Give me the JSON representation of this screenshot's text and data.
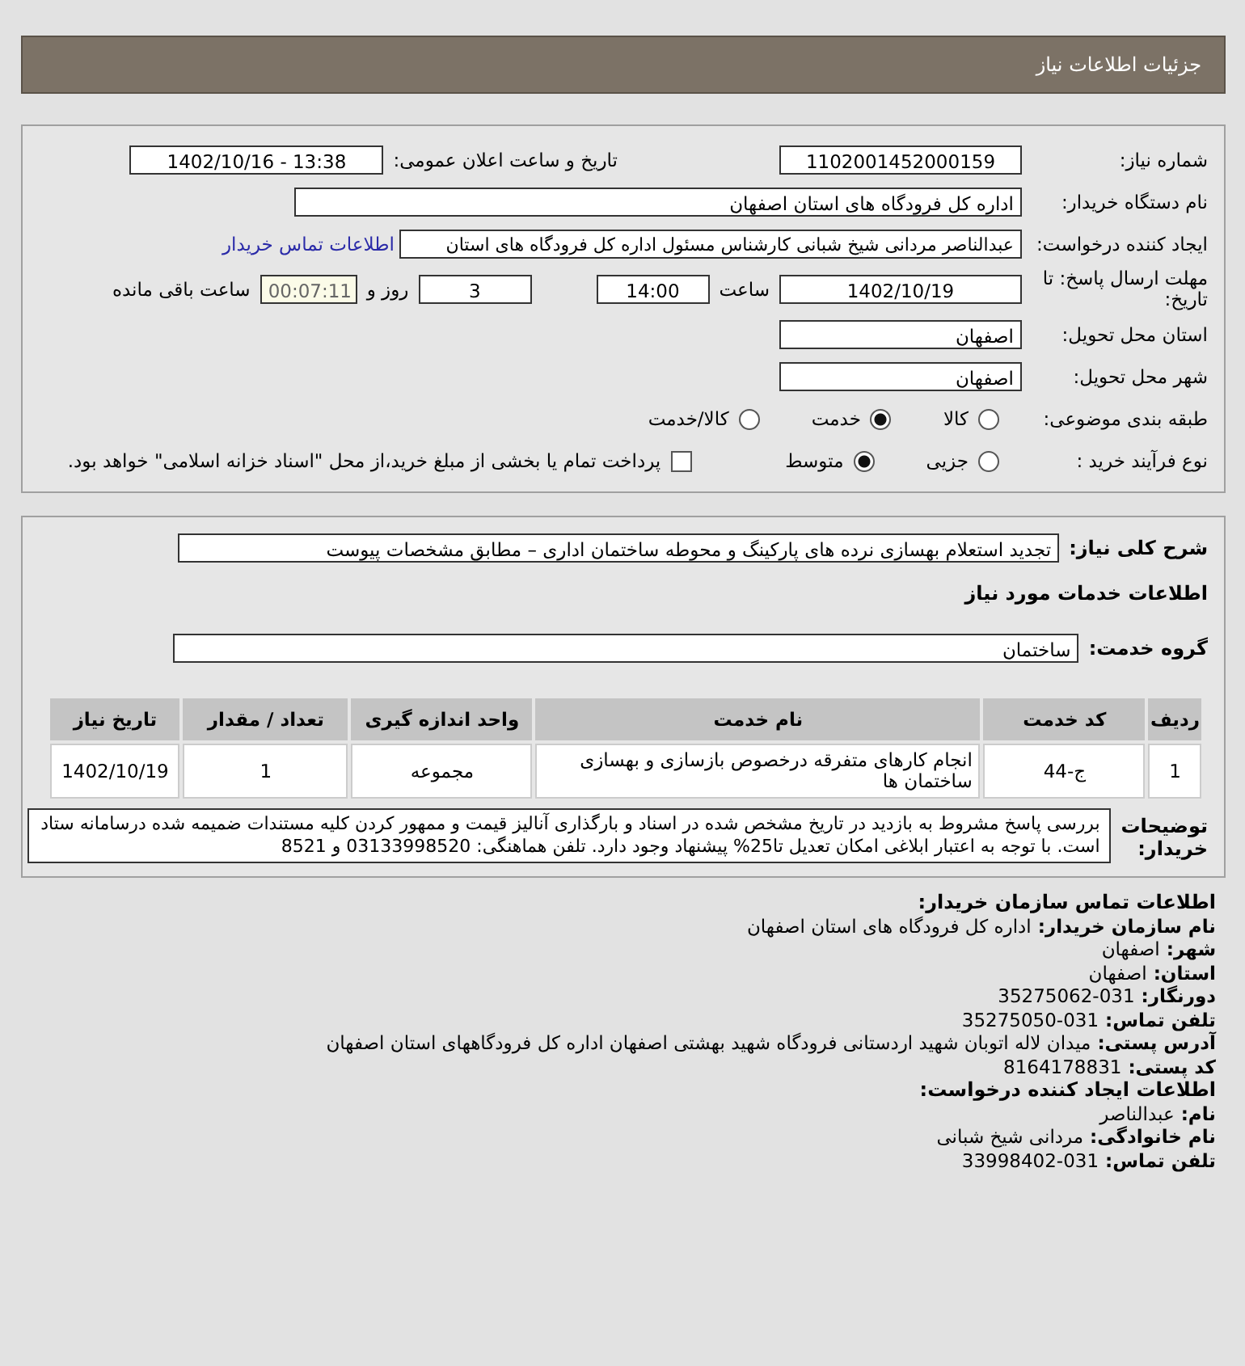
{
  "header": {
    "title": "جزئیات اطلاعات نیاز"
  },
  "details": {
    "need_number": {
      "label": "شماره نیاز:",
      "value": "1102001452000159"
    },
    "announce": {
      "label": "تاریخ و ساعت اعلان عمومی:",
      "value": "1402/10/16 - 13:38"
    },
    "buyer_org": {
      "label": "نام دستگاه خریدار:",
      "value": "اداره کل فرودگاه های استان اصفهان"
    },
    "creator": {
      "label": "ایجاد کننده درخواست:",
      "value": "عبدالناصر مردانی شیخ شبانی کارشناس مسئول  اداره کل فرودگاه های استان",
      "link": "اطلاعات تماس خریدار"
    },
    "deadline": {
      "label": "مهلت ارسال پاسخ: تا تاریخ:",
      "date": "1402/10/19",
      "time_label": "ساعت",
      "time": "14:00",
      "days": "3",
      "days_label": "روز و",
      "remaining": "00:07:11",
      "remaining_label": "ساعت باقی مانده"
    },
    "province": {
      "label": "استان محل تحویل:",
      "value": "اصفهان"
    },
    "city": {
      "label": "شهر محل تحویل:",
      "value": "اصفهان"
    },
    "category": {
      "label": "طبقه بندی موضوعی:",
      "options": [
        {
          "label": "کالا",
          "selected": false
        },
        {
          "label": "خدمت",
          "selected": true
        },
        {
          "label": "کالا/خدمت",
          "selected": false
        }
      ]
    },
    "process": {
      "label": "نوع فرآیند خرید :",
      "options": [
        {
          "label": "جزیی",
          "selected": false
        },
        {
          "label": "متوسط",
          "selected": true
        }
      ],
      "treasury": {
        "label": "پرداخت تمام یا بخشی از مبلغ خرید،از محل \"اسناد خزانه اسلامی\" خواهد بود.",
        "checked": false
      }
    }
  },
  "services": {
    "description": {
      "label": "شرح کلی نیاز:",
      "value": "تجدید استعلام بهسازی نرده های پارکینگ و محوطه ساختمان اداری – مطابق مشخصات پیوست"
    },
    "section_title": "اطلاعات خدمات مورد نیاز",
    "group": {
      "label": "گروه خدمت:",
      "value": "ساختمان"
    },
    "table": {
      "columns": [
        "ردیف",
        "کد خدمت",
        "نام خدمت",
        "واحد اندازه گیری",
        "تعداد / مقدار",
        "تاریخ نیاز"
      ],
      "rows": [
        [
          "1",
          "ج-44",
          "انجام کارهای متفرقه درخصوص بازسازی و بهسازی ساختمان ها",
          "مجموعه",
          "1",
          "1402/10/19"
        ]
      ]
    },
    "notes": {
      "label": "توضیحات خریدار:",
      "value": "بررسی پاسخ مشروط به بازدید در تاریخ مشخص شده در اسناد و بارگذاری آنالیز قیمت و ممهور کردن کلیه مستندات ضمیمه شده درسامانه ستاد است. با توجه به اعتبار ابلاغی امکان تعدیل تا25% پیشنهاد وجود دارد. تلفن هماهنگی: 03133998520 و 8521"
    }
  },
  "contact": {
    "title": "اطلاعات تماس سازمان خریدار:",
    "lines": [
      {
        "label": "نام سازمان خریدار:",
        "value": "اداره کل فرودگاه های استان اصفهان"
      },
      {
        "label": "شهر:",
        "value": "اصفهان"
      },
      {
        "label": "استان:",
        "value": "اصفهان"
      },
      {
        "label": "دورنگار:",
        "value": "35275062-031"
      },
      {
        "label": "تلفن تماس:",
        "value": "35275050-031"
      },
      {
        "label": "آدرس پستی:",
        "value": "میدان لاله اتوبان شهید اردستانی فرودگاه شهید بهشتی اصفهان اداره کل فرودگاههای استان اصفهان"
      },
      {
        "label": "کد پستی:",
        "value": "8164178831"
      }
    ],
    "creator_title": "اطلاعات ایجاد کننده درخواست:",
    "creator_lines": [
      {
        "label": "نام:",
        "value": "عبدالناصر"
      },
      {
        "label": "نام خانوادگی:",
        "value": "مردانی شیخ شبانی"
      },
      {
        "label": "تلفن تماس:",
        "value": "33998402-031"
      }
    ]
  }
}
